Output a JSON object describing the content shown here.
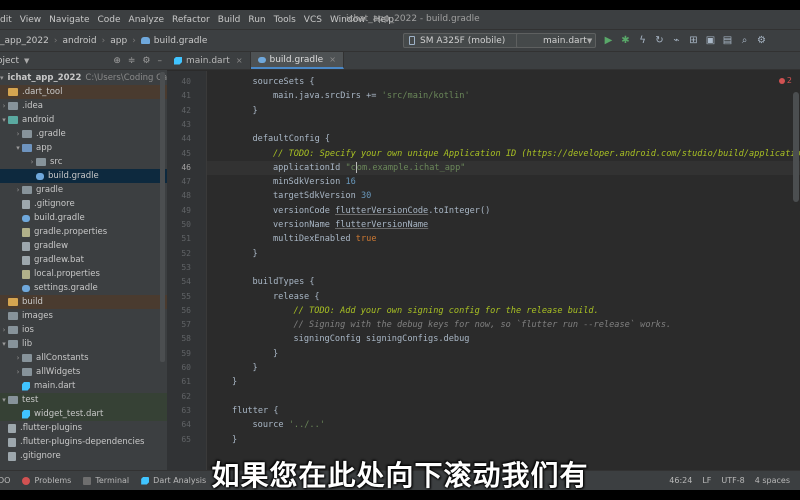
{
  "menubar": {
    "items": [
      "dit",
      "View",
      "Navigate",
      "Code",
      "Analyze",
      "Refactor",
      "Build",
      "Run",
      "Tools",
      "VCS",
      "Window",
      "Help"
    ],
    "window_title": "ichat_app_2022 - build.gradle"
  },
  "navbar": {
    "breadcrumbs": [
      "_app_2022",
      "android",
      "app",
      "build.gradle"
    ],
    "device": "SM A325F (mobile)",
    "run_config": "main.dart"
  },
  "project_panel": {
    "title": "oject",
    "rows": [
      {
        "label": "ichat_app_2022",
        "path": "C:\\Users\\Coding Cafe\\Desk",
        "indent": 0,
        "arrow": "▾",
        "icon": "folder",
        "style": "root"
      },
      {
        "label": ".dart_tool",
        "indent": 0,
        "arrow": "",
        "icon": "folder-yellow",
        "style": "hl-orange"
      },
      {
        "label": ".idea",
        "indent": 0,
        "arrow": "›",
        "icon": "folder",
        "style": ""
      },
      {
        "label": "android",
        "indent": 0,
        "arrow": "▾",
        "icon": "folder-teal",
        "style": ""
      },
      {
        "label": ".gradle",
        "indent": 1,
        "arrow": "›",
        "icon": "folder",
        "style": ""
      },
      {
        "label": "app",
        "indent": 1,
        "arrow": "▾",
        "icon": "folder-blue",
        "style": ""
      },
      {
        "label": "src",
        "indent": 2,
        "arrow": "›",
        "icon": "folder",
        "style": ""
      },
      {
        "label": "build.gradle",
        "indent": 2,
        "arrow": "",
        "icon": "gradle",
        "style": "selected"
      },
      {
        "label": "gradle",
        "indent": 1,
        "arrow": "›",
        "icon": "folder",
        "style": ""
      },
      {
        "label": ".gitignore",
        "indent": 1,
        "arrow": "",
        "icon": "file",
        "style": ""
      },
      {
        "label": "build.gradle",
        "indent": 1,
        "arrow": "",
        "icon": "gradle",
        "style": ""
      },
      {
        "label": "gradle.properties",
        "indent": 1,
        "arrow": "",
        "icon": "props",
        "style": ""
      },
      {
        "label": "gradlew",
        "indent": 1,
        "arrow": "",
        "icon": "file",
        "style": ""
      },
      {
        "label": "gradlew.bat",
        "indent": 1,
        "arrow": "",
        "icon": "file",
        "style": ""
      },
      {
        "label": "local.properties",
        "indent": 1,
        "arrow": "",
        "icon": "props",
        "style": ""
      },
      {
        "label": "settings.gradle",
        "indent": 1,
        "arrow": "",
        "icon": "gradle",
        "style": ""
      },
      {
        "label": "build",
        "indent": 0,
        "arrow": "",
        "icon": "folder-yellow",
        "style": "hl-orange"
      },
      {
        "label": "images",
        "indent": 0,
        "arrow": "",
        "icon": "folder",
        "style": ""
      },
      {
        "label": "ios",
        "indent": 0,
        "arrow": "›",
        "icon": "folder",
        "style": ""
      },
      {
        "label": "lib",
        "indent": 0,
        "arrow": "▾",
        "icon": "folder",
        "style": ""
      },
      {
        "label": "allConstants",
        "indent": 1,
        "arrow": "›",
        "icon": "folder",
        "style": ""
      },
      {
        "label": "allWidgets",
        "indent": 1,
        "arrow": "›",
        "icon": "folder",
        "style": ""
      },
      {
        "label": "main.dart",
        "indent": 1,
        "arrow": "",
        "icon": "dart",
        "style": ""
      },
      {
        "label": "test",
        "indent": 0,
        "arrow": "▾",
        "icon": "folder",
        "style": "hl-green"
      },
      {
        "label": "widget_test.dart",
        "indent": 1,
        "arrow": "",
        "icon": "dart",
        "style": "hl-green"
      },
      {
        "label": ".flutter-plugins",
        "indent": 0,
        "arrow": "",
        "icon": "file",
        "style": ""
      },
      {
        "label": ".flutter-plugins-dependencies",
        "indent": 0,
        "arrow": "",
        "icon": "file",
        "style": ""
      },
      {
        "label": ".gitignore",
        "indent": 0,
        "arrow": "",
        "icon": "file",
        "style": ""
      }
    ]
  },
  "editor": {
    "tabs": [
      {
        "label": "main.dart",
        "icon": "dart",
        "active": false
      },
      {
        "label": "build.gradle",
        "icon": "gradle",
        "active": true
      }
    ],
    "error_count": "2",
    "current_line": "46",
    "lines": [
      {
        "num": "40",
        "indent": 1,
        "tokens": [
          {
            "t": "sourceSets {",
            "c": "plain"
          }
        ]
      },
      {
        "num": "41",
        "indent": 2,
        "tokens": [
          {
            "t": "main.java.srcDirs += ",
            "c": "plain"
          },
          {
            "t": "'src/main/kotlin'",
            "c": "str"
          }
        ]
      },
      {
        "num": "42",
        "indent": 1,
        "tokens": [
          {
            "t": "}",
            "c": "plain"
          }
        ]
      },
      {
        "num": "43",
        "indent": 0,
        "tokens": []
      },
      {
        "num": "44",
        "indent": 1,
        "tokens": [
          {
            "t": "defaultConfig {",
            "c": "plain"
          }
        ]
      },
      {
        "num": "45",
        "indent": 2,
        "tokens": [
          {
            "t": "// TODO: Specify your own unique Application ID (https://developer.android.com/studio/build/application-id.h",
            "c": "todo"
          }
        ]
      },
      {
        "num": "46",
        "indent": 2,
        "tokens": [
          {
            "t": "applicationId ",
            "c": "plain"
          },
          {
            "t": "\"c",
            "c": "str"
          },
          {
            "t": "CARET",
            "c": "caret"
          },
          {
            "t": "om.example.ichat_app\"",
            "c": "str"
          }
        ]
      },
      {
        "num": "47",
        "indent": 2,
        "tokens": [
          {
            "t": "minSdkVersion ",
            "c": "plain"
          },
          {
            "t": "16",
            "c": "num"
          }
        ]
      },
      {
        "num": "48",
        "indent": 2,
        "tokens": [
          {
            "t": "targetSdkVersion ",
            "c": "plain"
          },
          {
            "t": "30",
            "c": "num"
          }
        ]
      },
      {
        "num": "49",
        "indent": 2,
        "tokens": [
          {
            "t": "versionCode ",
            "c": "plain"
          },
          {
            "t": "flutterVersionCode",
            "c": "und"
          },
          {
            "t": ".toInteger()",
            "c": "plain"
          }
        ]
      },
      {
        "num": "50",
        "indent": 2,
        "tokens": [
          {
            "t": "versionName ",
            "c": "plain"
          },
          {
            "t": "flutterVersionName",
            "c": "und"
          }
        ]
      },
      {
        "num": "51",
        "indent": 2,
        "tokens": [
          {
            "t": "multiDexEnabled ",
            "c": "plain"
          },
          {
            "t": "true",
            "c": "kw"
          }
        ]
      },
      {
        "num": "52",
        "indent": 1,
        "tokens": [
          {
            "t": "}",
            "c": "plain"
          }
        ]
      },
      {
        "num": "53",
        "indent": 0,
        "tokens": []
      },
      {
        "num": "54",
        "indent": 1,
        "tokens": [
          {
            "t": "buildTypes {",
            "c": "plain"
          }
        ]
      },
      {
        "num": "55",
        "indent": 2,
        "tokens": [
          {
            "t": "release {",
            "c": "plain"
          }
        ]
      },
      {
        "num": "56",
        "indent": 3,
        "tokens": [
          {
            "t": "// TODO: Add your own signing config for the release build.",
            "c": "todo"
          }
        ]
      },
      {
        "num": "57",
        "indent": 3,
        "tokens": [
          {
            "t": "// Signing with the debug keys for now, so `flutter run --release` works.",
            "c": "cmt"
          }
        ]
      },
      {
        "num": "58",
        "indent": 3,
        "tokens": [
          {
            "t": "signingConfig signingConfigs.debug",
            "c": "plain"
          }
        ]
      },
      {
        "num": "59",
        "indent": 2,
        "tokens": [
          {
            "t": "}",
            "c": "plain"
          }
        ]
      },
      {
        "num": "60",
        "indent": 1,
        "tokens": [
          {
            "t": "}",
            "c": "plain"
          }
        ]
      },
      {
        "num": "61",
        "indent": 0,
        "tokens": [
          {
            "t": "}",
            "c": "plain"
          }
        ]
      },
      {
        "num": "62",
        "indent": 0,
        "tokens": []
      },
      {
        "num": "63",
        "indent": 0,
        "tokens": [
          {
            "t": "flutter {",
            "c": "plain"
          }
        ]
      },
      {
        "num": "64",
        "indent": 1,
        "tokens": [
          {
            "t": "source ",
            "c": "plain"
          },
          {
            "t": "'../..'",
            "c": "str"
          }
        ]
      },
      {
        "num": "65",
        "indent": 0,
        "tokens": [
          {
            "t": "}",
            "c": "plain"
          }
        ]
      }
    ]
  },
  "bottombar": {
    "tools": [
      {
        "label": "DO",
        "icon": ""
      },
      {
        "label": "Problems",
        "icon": "err"
      },
      {
        "label": "Terminal",
        "icon": "term"
      },
      {
        "label": "Dart Analysis",
        "icon": "dart"
      }
    ],
    "status": [
      "46:24",
      "LF",
      "UTF-8",
      "4 spaces"
    ]
  },
  "subtitle": "如果您在此处向下滚动我们有"
}
